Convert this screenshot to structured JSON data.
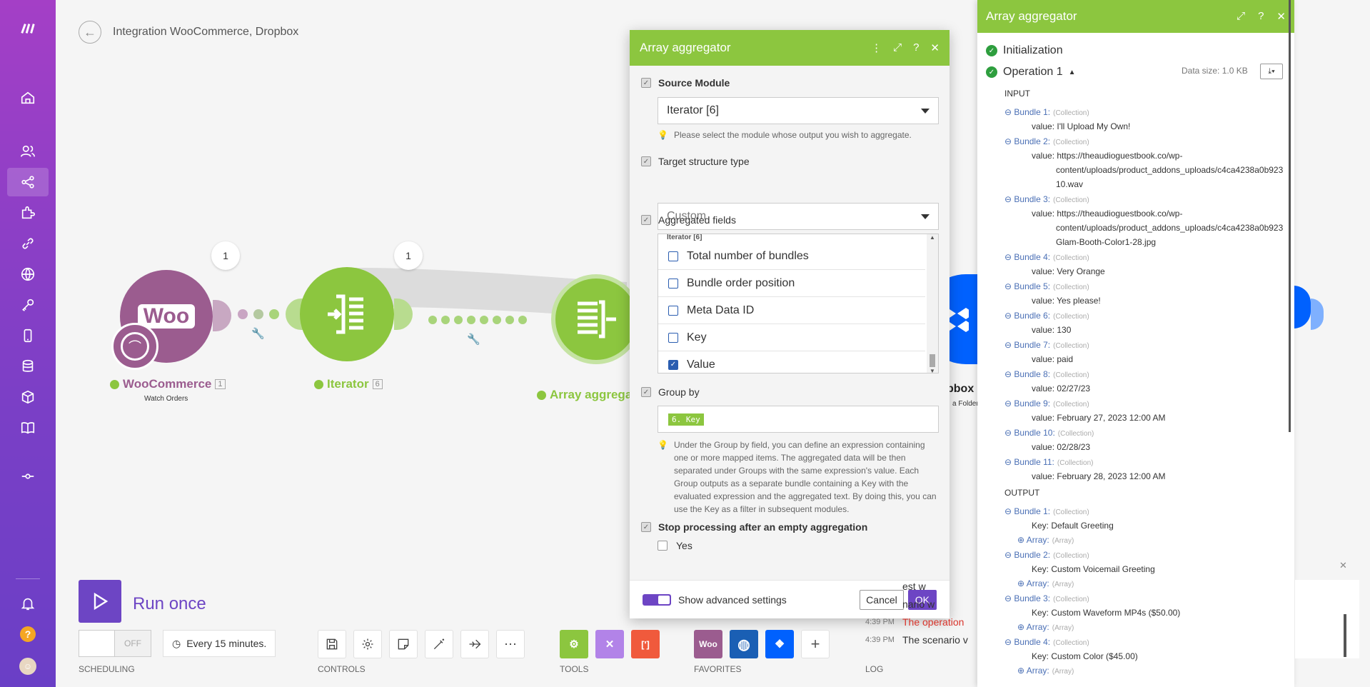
{
  "header": {
    "title": "Integration WooCommerce, Dropbox"
  },
  "modules": {
    "woo": {
      "name": "WooCommerce",
      "id": "1",
      "subtitle": "Watch Orders",
      "bubble": "1",
      "logo": "Woo"
    },
    "iterator": {
      "name": "Iterator",
      "id": "6",
      "bubble": "1"
    },
    "aggregator": {
      "name": "Array aggrega"
    },
    "dropbox": {
      "name": "pbox",
      "subtitle": "a Folder"
    }
  },
  "panel": {
    "title": "Array aggregator",
    "source_label": "Source Module",
    "source_value": "Iterator [6]",
    "source_hint": "Please select the module whose output you wish to aggregate.",
    "target_label": "Target structure type",
    "target_value": "Custom",
    "fields_label": "Aggregated fields",
    "fields_group": "Iterator [6]",
    "fields": [
      {
        "label": "Total number of bundles",
        "checked": false
      },
      {
        "label": "Bundle order position",
        "checked": false
      },
      {
        "label": "Meta Data ID",
        "checked": false
      },
      {
        "label": "Key",
        "checked": false
      },
      {
        "label": "Value",
        "checked": true
      }
    ],
    "group_label": "Group by",
    "group_pill": "6. Key",
    "group_hint": "Under the Group by field, you can define an expression containing one or more mapped items. The aggregated data will be then separated under Groups with the same expression's value. Each Group outputs as a separate bundle containing a Key with the evaluated expression and the aggregated text. By doing this, you can use the Key as a filter in subsequent modules.",
    "stop_label": "Stop processing after an empty aggregation",
    "stop_option": "Yes",
    "advanced": "Show advanced settings",
    "cancel": "Cancel",
    "ok": "OK"
  },
  "rpanel": {
    "title": "Array aggregator",
    "init": "Initialization",
    "operation": "Operation 1",
    "data_size": "Data size: 1.0 KB",
    "input_label": "INPUT",
    "output_label": "OUTPUT",
    "collection": "(Collection)",
    "array": "(Array)",
    "input": [
      {
        "b": "Bundle 1:",
        "v": [
          "I'll Upload My Own!"
        ]
      },
      {
        "b": "Bundle 2:",
        "v": [
          "https://theaudioguestbook.co/wp-",
          "content/uploads/product_addons_uploads/c4ca4238a0b923",
          "10.wav"
        ]
      },
      {
        "b": "Bundle 3:",
        "v": [
          "https://theaudioguestbook.co/wp-",
          "content/uploads/product_addons_uploads/c4ca4238a0b923",
          "Glam-Booth-Color1-28.jpg"
        ]
      },
      {
        "b": "Bundle 4:",
        "v": [
          "Very Orange"
        ]
      },
      {
        "b": "Bundle 5:",
        "v": [
          "Yes please!"
        ]
      },
      {
        "b": "Bundle 6:",
        "v": [
          "130"
        ]
      },
      {
        "b": "Bundle 7:",
        "v": [
          "paid"
        ]
      },
      {
        "b": "Bundle 8:",
        "v": [
          "02/27/23"
        ]
      },
      {
        "b": "Bundle 9:",
        "v": [
          "February 27, 2023 12:00 AM"
        ]
      },
      {
        "b": "Bundle 10:",
        "v": [
          "02/28/23"
        ]
      },
      {
        "b": "Bundle 11:",
        "v": [
          "February 28, 2023 12:00 AM"
        ]
      }
    ],
    "value_key": "value:",
    "output": [
      {
        "b": "Bundle 1:",
        "k": "Default Greeting"
      },
      {
        "b": "Bundle 2:",
        "k": "Custom Voicemail Greeting"
      },
      {
        "b": "Bundle 3:",
        "k": "Custom Waveform MP4s ($50.00)"
      },
      {
        "b": "Bundle 4:",
        "k": "Custom Color ($45.00)"
      }
    ],
    "key_key": "Key:",
    "array_key": "Array:"
  },
  "run": {
    "label": "Run once"
  },
  "scheduling": {
    "toggle": "OFF",
    "interval": "Every 15 minutes.",
    "label": "SCHEDULING"
  },
  "sections": {
    "controls": "CONTROLS",
    "tools": "TOOLS",
    "favorites": "FAVORITES",
    "log": "LOG"
  },
  "log": [
    {
      "time": "",
      "text": "est w"
    },
    {
      "time": "",
      "text": "nario w"
    },
    {
      "time": "4:39 PM",
      "text": "The operation",
      "color": "#d9342b"
    },
    {
      "time": "4:39 PM",
      "text": "The scenario v"
    }
  ],
  "colors": {
    "brand": "#8cc63f",
    "purple": "#6d45c4",
    "woo": "#9b5c8f",
    "dropbox": "#0061fe"
  }
}
